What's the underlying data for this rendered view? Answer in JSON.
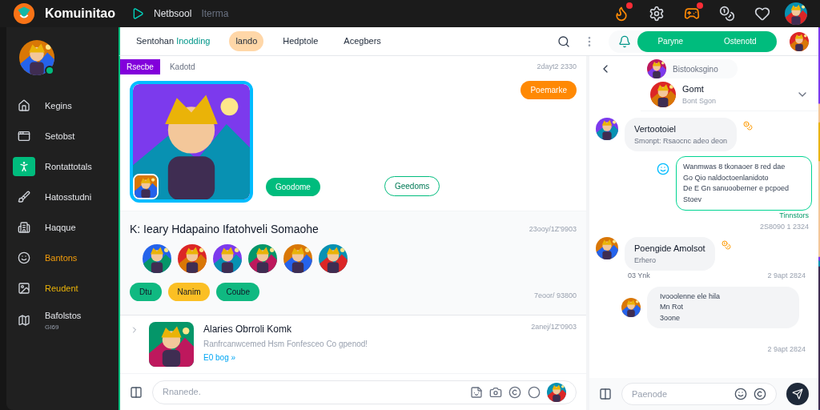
{
  "topbar": {
    "app_name": "Komuinitao",
    "links": [
      "Netbsool",
      "Iterma"
    ],
    "icons": [
      {
        "badge": true
      },
      {
        "badge": false
      },
      {
        "badge": true
      },
      {
        "badge": false
      },
      {
        "badge": false
      }
    ]
  },
  "sidebar": {
    "items": [
      {
        "label": "Kegins",
        "selected": false,
        "color": "#e5e7eb"
      },
      {
        "label": "Setobst",
        "selected": false,
        "color": "#e5e7eb"
      },
      {
        "label": "Rontattotals",
        "selected": true,
        "color": "#e5e7eb"
      },
      {
        "label": "Hatosstudni",
        "selected": false,
        "color": "#e5e7eb"
      },
      {
        "label": "Haqque",
        "selected": false,
        "color": "#e5e7eb"
      },
      {
        "label": "Bantons",
        "selected": false,
        "color": "#f59e0b"
      },
      {
        "label": "Reudent",
        "selected": false,
        "color": "#eab308"
      },
      {
        "label": "Bafolstos",
        "sub": "GI69",
        "selected": false,
        "color": "#e5e7eb"
      }
    ]
  },
  "header": {
    "tabs": [
      {
        "label": "Sentohan",
        "accent": "Inodding",
        "selected": false
      },
      {
        "label": "lando",
        "selected": true
      },
      {
        "label": "Hedptole",
        "selected": false
      },
      {
        "label": "Acegbers",
        "selected": false
      }
    ],
    "toggle": {
      "options": [
        {
          "label": "Paryne",
          "selected": true
        },
        {
          "label": "Ostenotd",
          "selected": true
        }
      ]
    }
  },
  "feed": {
    "post": {
      "tag": "Rsecbe",
      "author": "Kadotd",
      "date": "2dayt2 2330",
      "action": "Poemarke",
      "buttons": [
        {
          "label": "Goodome",
          "kind": "filled"
        },
        {
          "label": "Geedoms",
          "kind": "outline"
        }
      ]
    },
    "team": {
      "title": "K: Ieary Hdapaino Ifatohveli Somaohe",
      "date": "23ooy/1Z'9903",
      "chips": [
        {
          "label": "Dtu",
          "color": "#10b981"
        },
        {
          "label": "Nanim",
          "color": "#fbbf24"
        },
        {
          "label": "Coube",
          "color": "#10b981"
        }
      ],
      "date2": "7eoor/ 93800"
    },
    "item": {
      "title": "Alaries Obrroli Komk",
      "text": "Ranfrcanwcemed Hsm Fonfesceo Co gpenod!",
      "link": "E0 bog »",
      "date": "2anej/1Z'0903"
    },
    "composer": {
      "placeholder": "Rnanede."
    }
  },
  "chat": {
    "chip": "Bistooksgino",
    "contact": {
      "name": "Gomt",
      "status": "Bont Sgon"
    },
    "messages": [
      {
        "kind": "incoming",
        "name": "Vertootoiel",
        "text": "Smonpt: Rsaocnc adeo deon"
      },
      {
        "kind": "outgoing",
        "lines": [
          "Wanmwas 8 tkonaoer 8 red dae",
          "Go Qio naldoctoenlanidoto",
          "De E Gn sanuooberner e pcpoed",
          "Stoev"
        ],
        "status": "Tinnstors",
        "time": "2S8090 1 2324"
      },
      {
        "kind": "incoming",
        "name": "Poengide Amolsot",
        "text": "Erhero",
        "meta": "03 Ynk",
        "time": "2 9apt 2824"
      },
      {
        "kind": "reply",
        "lines": [
          "Ivooolenne ele hila",
          "Mn Rot",
          "3oone"
        ],
        "time": "2 9apt 2824"
      }
    ],
    "composer": {
      "placeholder": "Paenode"
    }
  }
}
